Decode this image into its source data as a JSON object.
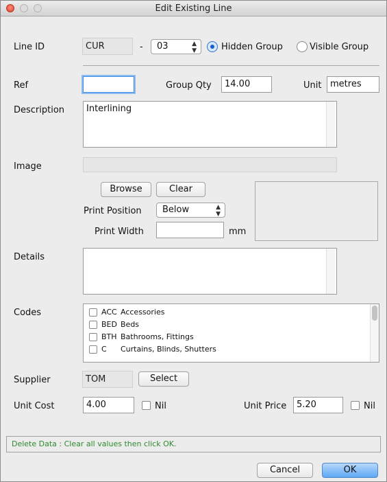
{
  "window": {
    "title": "Edit Existing Line"
  },
  "line": {
    "label": "Line ID",
    "id_value": "CUR",
    "dash": "-",
    "number_value": "03",
    "hidden_group_label": "Hidden Group",
    "visible_group_label": "Visible Group",
    "selected_group": "hidden"
  },
  "ref": {
    "label": "Ref",
    "value": ""
  },
  "group_qty": {
    "label": "Group Qty",
    "value": "14.00"
  },
  "unit": {
    "label": "Unit",
    "value": "metres"
  },
  "description": {
    "label": "Description",
    "value": "Interlining"
  },
  "image": {
    "label": "Image",
    "path_value": "",
    "browse_label": "Browse",
    "clear_label": "Clear",
    "print_position_label": "Print Position",
    "print_position_value": "Below",
    "print_width_label": "Print Width",
    "print_width_value": "",
    "print_width_unit": "mm"
  },
  "details": {
    "label": "Details",
    "value": ""
  },
  "codes": {
    "label": "Codes",
    "items": [
      {
        "code": "ACC",
        "name": "Accessories",
        "checked": false
      },
      {
        "code": "BED",
        "name": "Beds",
        "checked": false
      },
      {
        "code": "BTH",
        "name": "Bathrooms, Fittings",
        "checked": false
      },
      {
        "code": "C",
        "name": "Curtains, Blinds, Shutters",
        "checked": false
      }
    ]
  },
  "supplier": {
    "label": "Supplier",
    "value": "TOM",
    "select_label": "Select"
  },
  "unit_cost": {
    "label": "Unit Cost",
    "value": "4.00",
    "nil_label": "Nil"
  },
  "unit_price": {
    "label": "Unit Price",
    "value": "5.20",
    "nil_label": "Nil"
  },
  "status_text": "Delete Data : Clear all values then click OK.",
  "footer": {
    "cancel_label": "Cancel",
    "ok_label": "OK"
  }
}
